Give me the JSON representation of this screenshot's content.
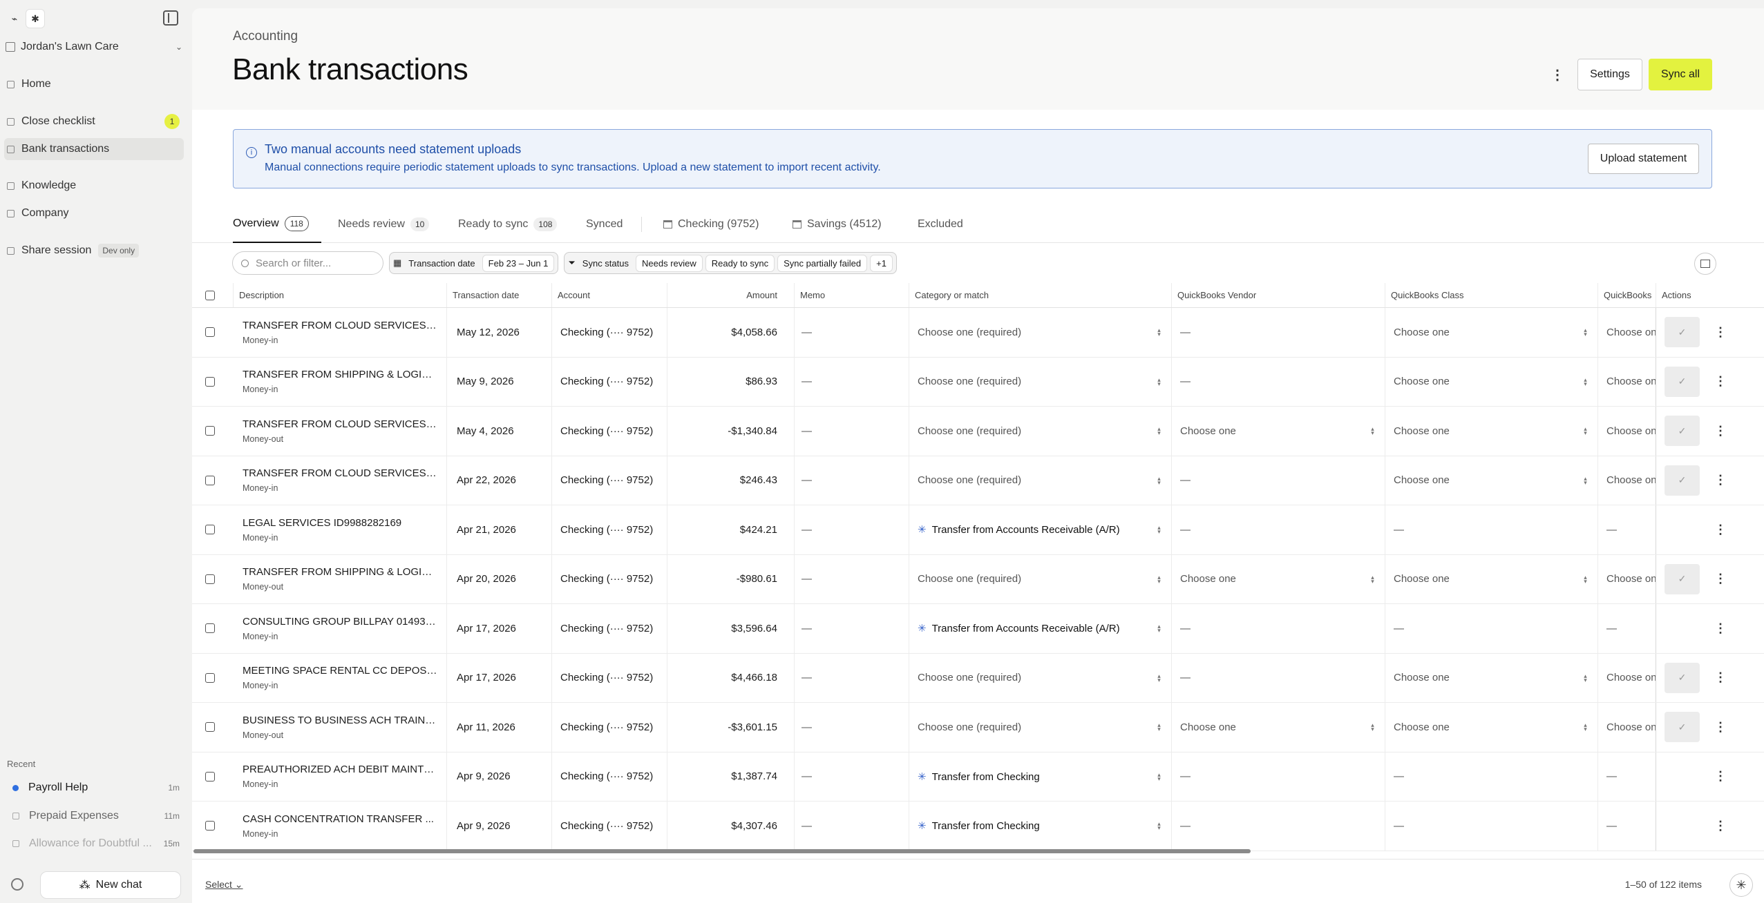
{
  "sidebar": {
    "company": "Jordan's Lawn Care",
    "nav": [
      {
        "label": "Home"
      },
      {
        "label": "Close checklist",
        "badge": "1"
      },
      {
        "label": "Bank transactions"
      },
      {
        "label": "Knowledge"
      },
      {
        "label": "Company"
      },
      {
        "label": "Share session",
        "tag": "Dev only"
      }
    ],
    "recent_label": "Recent",
    "recent": [
      {
        "title": "Payroll Help",
        "time": "1m"
      },
      {
        "title": "Prepaid Expenses",
        "time": "11m"
      },
      {
        "title": "Allowance for Doubtful ...",
        "time": "15m"
      }
    ],
    "new_chat": "New chat"
  },
  "header": {
    "breadcrumb": "Accounting",
    "title": "Bank transactions",
    "settings": "Settings",
    "sync_all": "Sync all"
  },
  "alert": {
    "title": "Two manual accounts need statement uploads",
    "body": "Manual connections require periodic statement uploads to sync transactions. Upload a new statement to import recent activity.",
    "button": "Upload statement"
  },
  "tabs": [
    {
      "label": "Overview",
      "count": "118"
    },
    {
      "label": "Needs review",
      "count": "10"
    },
    {
      "label": "Ready to sync",
      "count": "108"
    },
    {
      "label": "Synced"
    },
    {
      "label": "Checking (9752)"
    },
    {
      "label": "Savings (4512)"
    },
    {
      "label": "Excluded"
    }
  ],
  "filters": {
    "search_placeholder": "Search or filter...",
    "date_label": "Transaction date",
    "date_value": "Feb 23 – Jun 1",
    "status_label": "Sync status",
    "status_values": [
      "Needs review",
      "Ready to sync",
      "Sync partially failed",
      "+1"
    ]
  },
  "columns": {
    "description": "Description",
    "date": "Transaction date",
    "account": "Account",
    "amount": "Amount",
    "memo": "Memo",
    "category": "Category or match",
    "vendor": "QuickBooks Vendor",
    "class": "QuickBooks Class",
    "qb": "QuickBooks",
    "actions": "Actions"
  },
  "rows": [
    {
      "desc": "TRANSFER FROM CLOUD SERVICES I...",
      "type": "Money-in",
      "date": "May 12, 2026",
      "account": "Checking (···· 9752)",
      "amount": "$4,058.66",
      "memo": "—",
      "category": "Choose one (required)",
      "vendor": "—",
      "class": "Choose one",
      "qb": "Choose one"
    },
    {
      "desc": "TRANSFER FROM SHIPPING & LOGIST...",
      "type": "Money-in",
      "date": "May 9, 2026",
      "account": "Checking (···· 9752)",
      "amount": "$86.93",
      "memo": "—",
      "category": "Choose one (required)",
      "vendor": "—",
      "class": "Choose one",
      "qb": "Choose one"
    },
    {
      "desc": "TRANSFER FROM CLOUD SERVICES I...",
      "type": "Money-out",
      "date": "May 4, 2026",
      "account": "Checking (···· 9752)",
      "amount": "-$1,340.84",
      "memo": "—",
      "category": "Choose one (required)",
      "vendor": "Choose one",
      "class": "Choose one",
      "qb": "Choose one"
    },
    {
      "desc": "TRANSFER FROM CLOUD SERVICES I...",
      "type": "Money-in",
      "date": "Apr 22, 2026",
      "account": "Checking (···· 9752)",
      "amount": "$246.43",
      "memo": "—",
      "category": "Choose one (required)",
      "vendor": "—",
      "class": "Choose one",
      "qb": "Choose one"
    },
    {
      "desc": "LEGAL SERVICES ID9988282169",
      "type": "Money-in",
      "date": "Apr 21, 2026",
      "account": "Checking (···· 9752)",
      "amount": "$424.21",
      "memo": "—",
      "category": "Transfer from Accounts Receivable (A/R)",
      "vendor": "—",
      "class": "—",
      "qb": "—"
    },
    {
      "desc": "TRANSFER FROM SHIPPING & LOGIST...",
      "type": "Money-out",
      "date": "Apr 20, 2026",
      "account": "Checking (···· 9752)",
      "amount": "-$980.61",
      "memo": "—",
      "category": "Choose one (required)",
      "vendor": "Choose one",
      "class": "Choose one",
      "qb": "Choose one"
    },
    {
      "desc": "CONSULTING GROUP BILLPAY 014932...",
      "type": "Money-in",
      "date": "Apr 17, 2026",
      "account": "Checking (···· 9752)",
      "amount": "$3,596.64",
      "memo": "—",
      "category": "Transfer from Accounts Receivable (A/R)",
      "vendor": "—",
      "class": "—",
      "qb": "—"
    },
    {
      "desc": "MEETING SPACE RENTAL CC DEPOSI...",
      "type": "Money-in",
      "date": "Apr 17, 2026",
      "account": "Checking (···· 9752)",
      "amount": "$4,466.18",
      "memo": "—",
      "category": "Choose one (required)",
      "vendor": "—",
      "class": "Choose one",
      "qb": "Choose one"
    },
    {
      "desc": "BUSINESS TO BUSINESS ACH TRAININ...",
      "type": "Money-out",
      "date": "Apr 11, 2026",
      "account": "Checking (···· 9752)",
      "amount": "-$3,601.15",
      "memo": "—",
      "category": "Choose one (required)",
      "vendor": "Choose one",
      "class": "Choose one",
      "qb": "Choose one"
    },
    {
      "desc": "PREAUTHORIZED ACH DEBIT MAINTE...",
      "type": "Money-in",
      "date": "Apr 9, 2026",
      "account": "Checking (···· 9752)",
      "amount": "$1,387.74",
      "memo": "—",
      "category": "Transfer from Checking",
      "vendor": "—",
      "class": "—",
      "qb": "—"
    },
    {
      "desc": "CASH CONCENTRATION TRANSFER ...",
      "type": "Money-in",
      "date": "Apr 9, 2026",
      "account": "Checking (···· 9752)",
      "amount": "$4,307.46",
      "memo": "—",
      "category": "Transfer from Checking",
      "vendor": "—",
      "class": "—",
      "qb": "—"
    }
  ],
  "footer": {
    "select": "Select",
    "count": "1–50 of 122 items"
  }
}
